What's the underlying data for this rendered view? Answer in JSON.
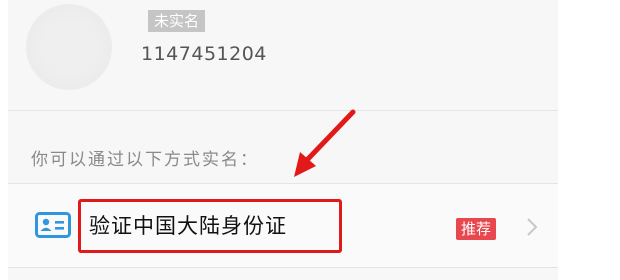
{
  "profile": {
    "status_badge": "未实名",
    "user_id": "1147451204"
  },
  "hint": "你可以通过以下方式实名：",
  "option": {
    "label": "验证中国大陆身份证",
    "tag": "推荐"
  },
  "colors": {
    "accent_blue": "#2f96e0",
    "tag_red": "#e8474d",
    "annotation_red": "#e21919"
  }
}
